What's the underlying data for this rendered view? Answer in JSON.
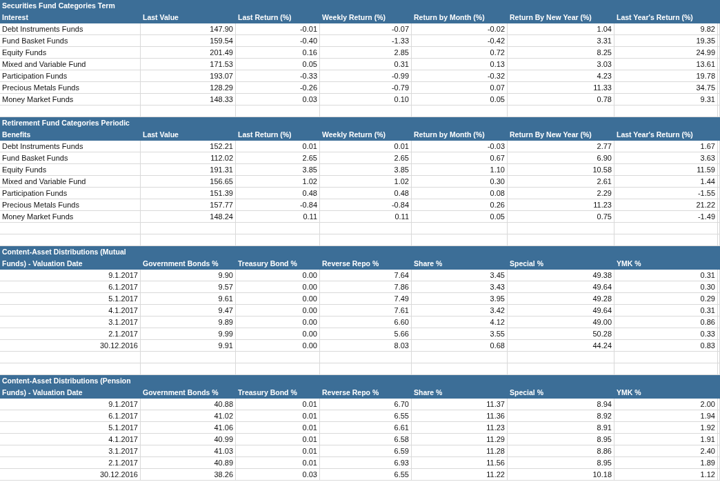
{
  "tables": [
    {
      "kind": "fund_returns",
      "header_lines": [
        "Securities Fund Categories Term",
        "Interest"
      ],
      "columns": [
        "Last Value",
        "Last Return (%)",
        "Weekly Return (%)",
        "Return by Month (%)",
        "Return By New Year (%)",
        "Last Year's Return (%)"
      ],
      "rows": [
        [
          "Debt Instruments Funds",
          "147.90",
          "-0.01",
          "-0.07",
          "-0.02",
          "1.04",
          "9.82"
        ],
        [
          "Fund Basket Funds",
          "159.54",
          "-0.40",
          "-1.33",
          "-0.42",
          "3.31",
          "19.35"
        ],
        [
          "Equity Funds",
          "201.49",
          "0.16",
          "2.85",
          "0.72",
          "8.25",
          "24.99"
        ],
        [
          "Mixed and Variable Fund",
          "171.53",
          "0.05",
          "0.31",
          "0.13",
          "3.03",
          "13.61"
        ],
        [
          "Participation Funds",
          "193.07",
          "-0.33",
          "-0.99",
          "-0.32",
          "4.23",
          "19.78"
        ],
        [
          "Precious Metals Funds",
          "128.29",
          "-0.26",
          "-0.79",
          "0.07",
          "11.33",
          "34.75"
        ],
        [
          "Money Market Funds",
          "148.33",
          "0.03",
          "0.10",
          "0.05",
          "0.78",
          "9.31"
        ]
      ]
    },
    {
      "kind": "fund_returns",
      "header_lines": [
        "Retirement Fund Categories Periodic",
        "Benefits"
      ],
      "columns": [
        "Last Value",
        "Last Return (%)",
        "Weekly Return (%)",
        "Return by Month (%)",
        "Return By New Year (%)",
        "Last Year's Return (%)"
      ],
      "rows": [
        [
          "Debt Instruments Funds",
          "152.21",
          "0.01",
          "0.01",
          "-0.03",
          "2.77",
          "1.67"
        ],
        [
          "Fund Basket Funds",
          "112.02",
          "2.65",
          "2.65",
          "0.67",
          "6.90",
          "3.63"
        ],
        [
          "Equity Funds",
          "191.31",
          "3.85",
          "3.85",
          "1.10",
          "10.58",
          "11.59"
        ],
        [
          "Mixed and Variable Fund",
          "156.65",
          "1.02",
          "1.02",
          "0.30",
          "2.61",
          "1.44"
        ],
        [
          "Participation Funds",
          "151.39",
          "0.48",
          "0.48",
          "0.08",
          "2.29",
          "-1.55"
        ],
        [
          "Precious Metals Funds",
          "157.77",
          "-0.84",
          "-0.84",
          "0.26",
          "11.23",
          "21.22"
        ],
        [
          "Money Market Funds",
          "148.24",
          "0.11",
          "0.11",
          "0.05",
          "0.75",
          "-1.49"
        ]
      ]
    },
    {
      "kind": "distributions",
      "header_lines": [
        "Content-Asset Distributions (Mutual",
        "Funds) - Valuation Date"
      ],
      "columns": [
        "Government Bonds %",
        "Treasury Bond %",
        "Reverse Repo %",
        "Share %",
        "Special %",
        "YMK %"
      ],
      "rows": [
        [
          "9.1.2017",
          "9.90",
          "0.00",
          "7.64",
          "3.45",
          "49.38",
          "0.31"
        ],
        [
          "6.1.2017",
          "9.57",
          "0.00",
          "7.86",
          "3.43",
          "49.64",
          "0.30"
        ],
        [
          "5.1.2017",
          "9.61",
          "0.00",
          "7.49",
          "3.95",
          "49.28",
          "0.29"
        ],
        [
          "4.1.2017",
          "9.47",
          "0.00",
          "7.61",
          "3.42",
          "49.64",
          "0.31"
        ],
        [
          "3.1.2017",
          "9.89",
          "0.00",
          "6.60",
          "4.12",
          "49.00",
          "0.86"
        ],
        [
          "2.1.2017",
          "9.99",
          "0.00",
          "5.66",
          "3.55",
          "50.28",
          "0.33"
        ],
        [
          "30.12.2016",
          "9.91",
          "0.00",
          "8.03",
          "0.68",
          "44.24",
          "0.83"
        ]
      ]
    },
    {
      "kind": "distributions",
      "header_lines": [
        "Content-Asset Distributions (Pension",
        "Funds) - Valuation Date"
      ],
      "columns": [
        "Government Bonds %",
        "Treasury Bond %",
        "Reverse Repo %",
        "Share %",
        "Special %",
        "YMK %"
      ],
      "rows": [
        [
          "9.1.2017",
          "40.88",
          "0.01",
          "6.70",
          "11.37",
          "8.94",
          "2.00"
        ],
        [
          "6.1.2017",
          "41.02",
          "0.01",
          "6.55",
          "11.36",
          "8.92",
          "1.94"
        ],
        [
          "5.1.2017",
          "41.06",
          "0.01",
          "6.61",
          "11.23",
          "8.91",
          "1.92"
        ],
        [
          "4.1.2017",
          "40.99",
          "0.01",
          "6.58",
          "11.29",
          "8.95",
          "1.91"
        ],
        [
          "3.1.2017",
          "41.03",
          "0.01",
          "6.59",
          "11.28",
          "8.86",
          "2.40"
        ],
        [
          "2.1.2017",
          "40.89",
          "0.01",
          "6.93",
          "11.56",
          "8.95",
          "1.89"
        ],
        [
          "30.12.2016",
          "38.26",
          "0.03",
          "6.55",
          "11.22",
          "10.18",
          "1.12"
        ]
      ]
    }
  ]
}
